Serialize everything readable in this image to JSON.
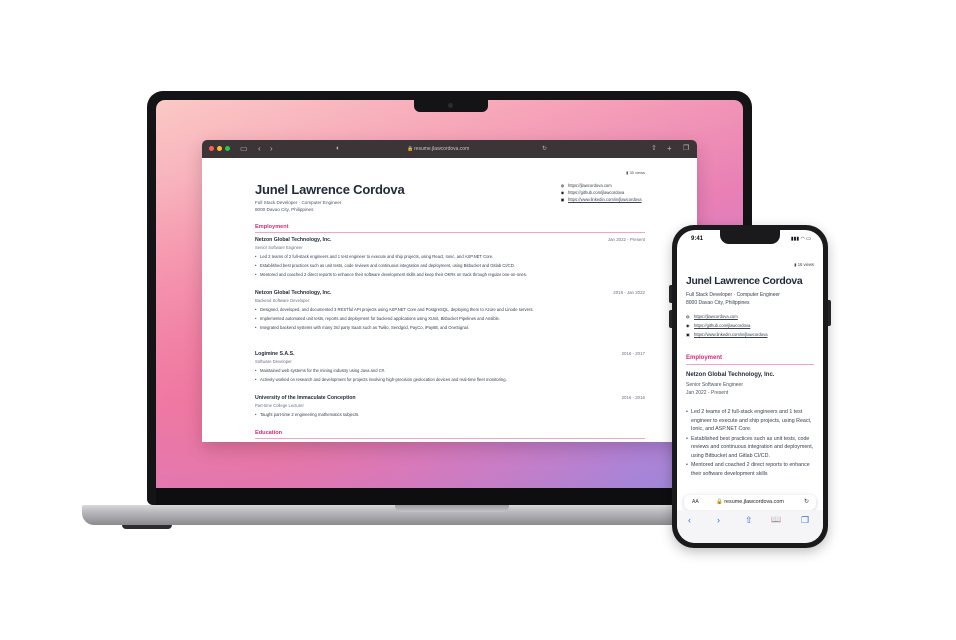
{
  "browser": {
    "url": "resume.jlawcordova.com",
    "url_lock": "🔒"
  },
  "resume": {
    "views": "35 views",
    "name": "Junel Lawrence Cordova",
    "title_line": "Full Stack Developer · Computer Engineer",
    "location": "8000 Davao City, Philippines",
    "links": [
      {
        "icon": "globe-icon",
        "glyph": "◍",
        "text": "https://jlawcordova.com"
      },
      {
        "icon": "github-icon",
        "glyph": "◉",
        "text": "https://github.com/jlawcordova"
      },
      {
        "icon": "linkedin-icon",
        "glyph": "▣",
        "text": "https://www.linkedin.com/in/jlawcordova"
      }
    ],
    "employment_heading": "Employment",
    "education_heading": "Education",
    "jobs": [
      {
        "company": "Netzon Global Technology, Inc.",
        "role": "Senior Software Engineer",
        "dates": "Jan 2022 - Present",
        "bullets": [
          "Led 2 teams of 2 full-stack engineers and 1 test engineer to execute and ship projects, using React, Ionic, and ASP.NET Core.",
          "Established best practices such as unit tests, code reviews and continuous integration and deployment, using Bitbucket and Gitlab CI/CD.",
          "Mentored and coached 2 direct reports to enhance their software development skills and keep their OKRs on track through regular one-on-ones."
        ]
      },
      {
        "company": "Netzon Global Technology, Inc.",
        "role": "Backend Software Developer",
        "dates": "2018 - Jan 2022",
        "bullets": [
          "Designed, developed, and documented 3 RESTful API projects using ASP.NET Core and PostgreSQL, deploying them to Azure and Linode servers.",
          "Implemented automated unit tests, reports and deployment for backend applications using XUnit, Bitbucket Pipelines and Ansible.",
          "Integrated backend systems with many 3rd party SaaS such as Twilio, Sendgrid, PayCo, iPay88, and OneSignal."
        ]
      },
      {
        "company": "Logimine S.A.S.",
        "role": "Software Developer",
        "dates": "2016 - 2017",
        "bullets": [
          "Maintained web systems for the mining industry using Java and C#.",
          "Actively worked on research and development for projects involving high-precision geolocation devices and real-time fleet monitoring."
        ]
      },
      {
        "company": "University of the Immaculate Conception",
        "role": "Part-time College Lecturer",
        "dates": "2016 - 2016",
        "bullets": [
          "Taught part-time 2 engineering mathematics subjects."
        ]
      }
    ]
  },
  "phone": {
    "time": "9:41",
    "status": "▮▮▮ ◠ ▭",
    "views": "16 views",
    "name": "Junel Lawrence Cordova",
    "title_line": "Full Stack Developer · Computer Engineer",
    "location": "8000 Davao City, Philippines",
    "links": [
      {
        "icon": "globe-icon",
        "glyph": "◍",
        "text": "https://jlawcordova.com"
      },
      {
        "icon": "github-icon",
        "glyph": "◉",
        "text": "https://github.com/jlawcordova"
      },
      {
        "icon": "linkedin-icon",
        "glyph": "▣",
        "text": "https://www.linkedin.com/in/jlawcordova"
      }
    ],
    "employment_heading": "Employment",
    "company": "Netzon Global Technology, Inc.",
    "role": "Senior Software Engineer",
    "dates": "Jan 2022 - Present",
    "bullets": [
      "Led 2 teams of 2 full-stack engineers and 1 test engineer to execute and ship projects, using React, Ionic, and ASP.NET Core.",
      "Established best practices such as unit tests, code reviews and continuous integration and deployment, using Bitbucket and Gitlab CI/CD.",
      "Mentored and coached 2 direct reports to enhance their software development skills"
    ],
    "aa_label": "AA",
    "url": "resume.jlawcordova.com",
    "reload_glyph": "↻",
    "toolbar": {
      "back": "‹",
      "forward": "›",
      "share": "⇧",
      "bookmarks": "📖",
      "tabs": "❐"
    }
  },
  "colors": {
    "accent": "#db2777",
    "heading": "#1f2937",
    "ios_blue": "#2f6fed"
  }
}
